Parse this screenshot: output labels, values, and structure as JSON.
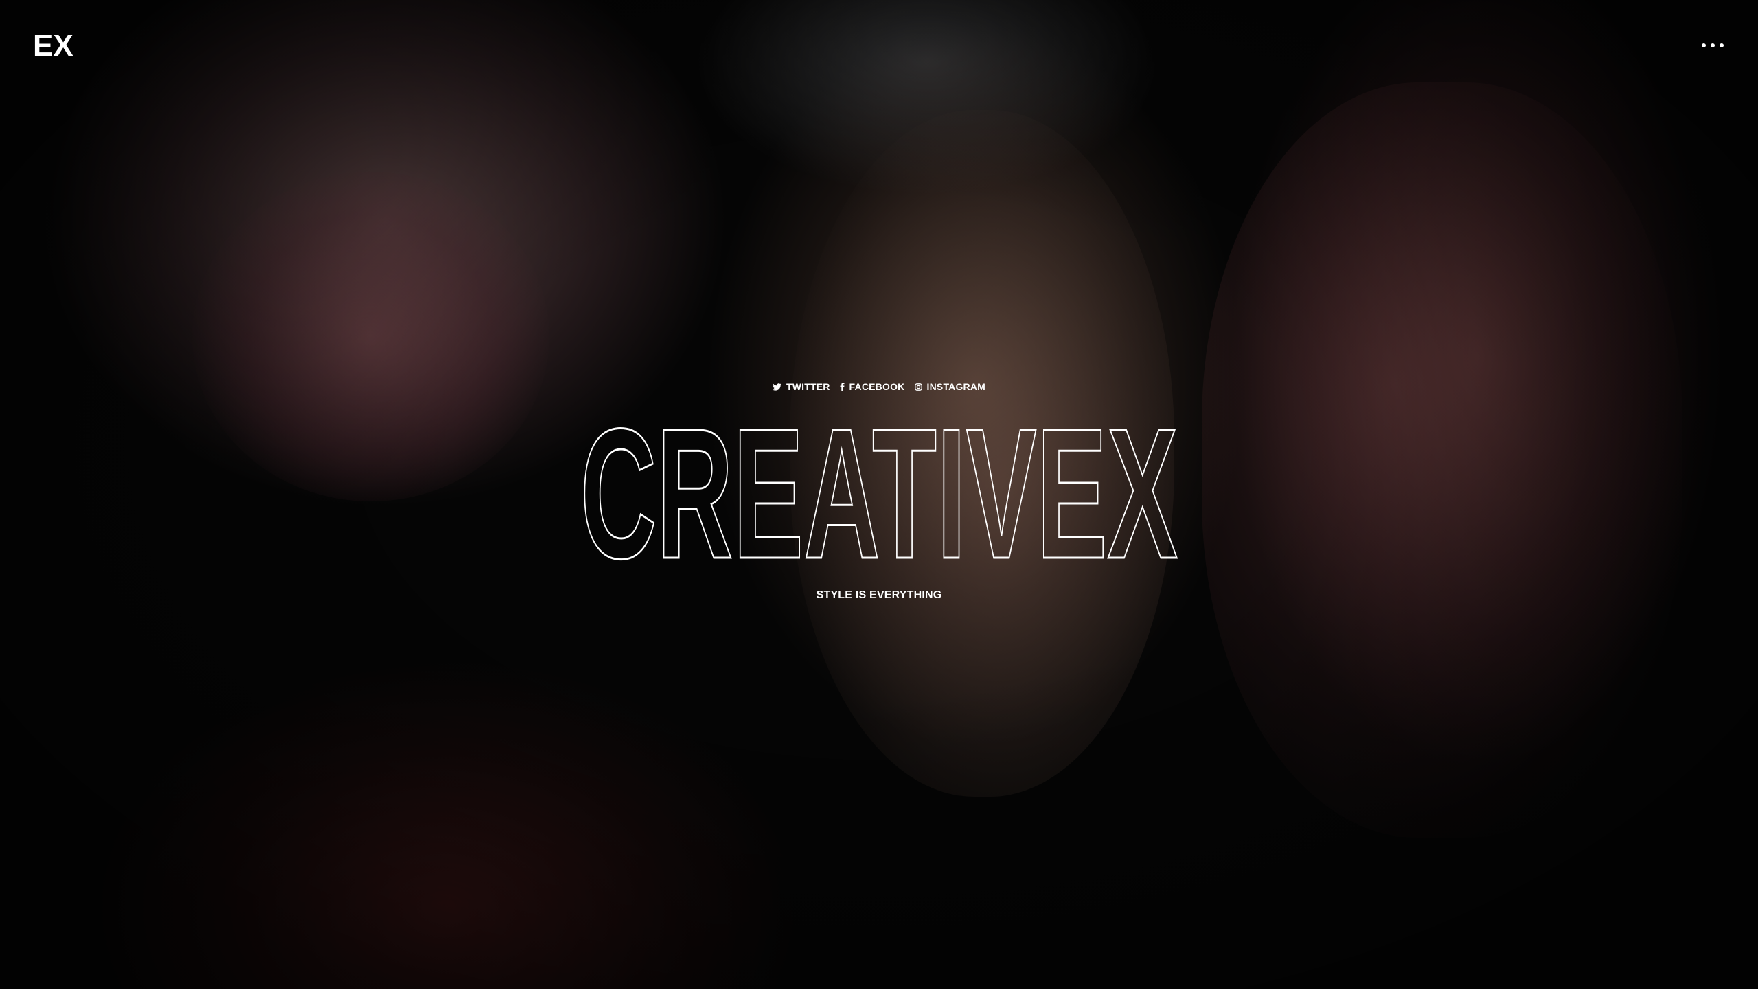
{
  "brand": {
    "logo_text": "EX",
    "title": "CREATIVEX",
    "tagline": "STYLE IS EVERYTHING"
  },
  "social": [
    {
      "label": "TWITTER",
      "icon": "twitter-icon"
    },
    {
      "label": "FACEBOOK",
      "icon": "facebook-icon"
    },
    {
      "label": "INSTAGRAM",
      "icon": "instagram-icon"
    }
  ],
  "menu": {
    "icon": "more-horizontal-icon"
  },
  "colors": {
    "text": "#ffffff",
    "background": "#050505"
  }
}
